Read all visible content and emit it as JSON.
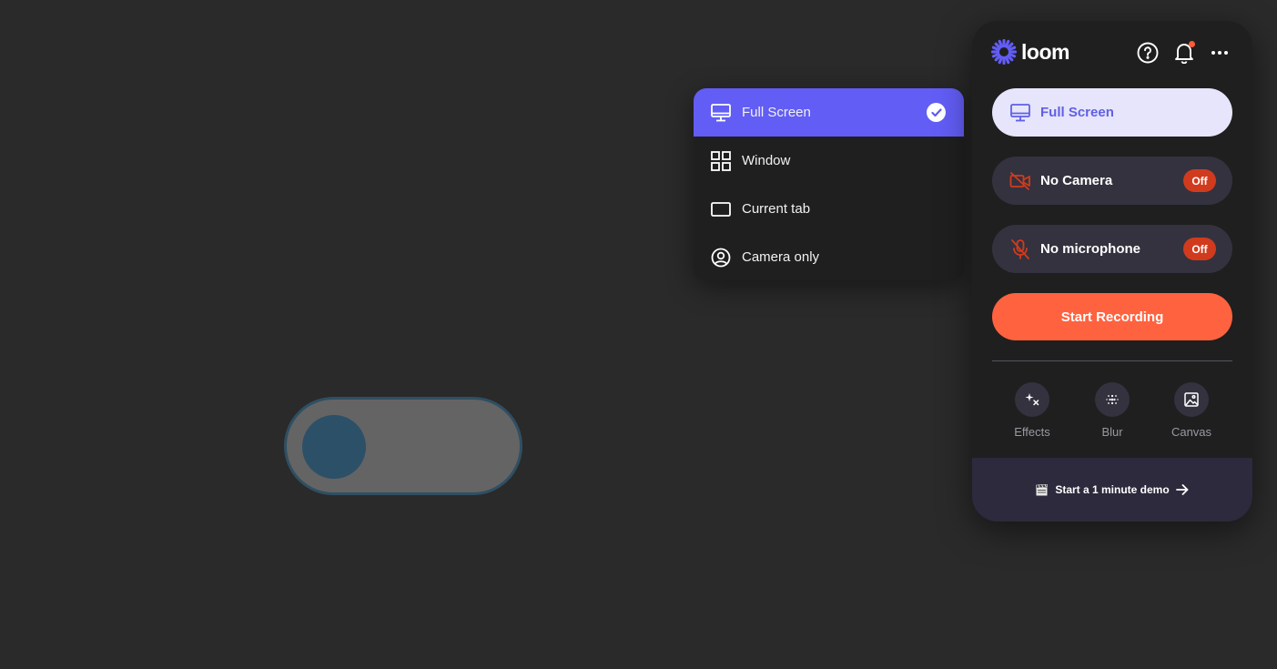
{
  "colors": {
    "accent": "#625df5",
    "record": "#ff623f",
    "off_badge": "#d13b1d",
    "panel_bg": "#1f1f1f"
  },
  "dropdown": {
    "items": [
      {
        "label": "Full Screen",
        "icon": "monitor-icon",
        "selected": true
      },
      {
        "label": "Window",
        "icon": "grid-icon",
        "selected": false
      },
      {
        "label": "Current tab",
        "icon": "tab-icon",
        "selected": false
      },
      {
        "label": "Camera only",
        "icon": "user-circle-icon",
        "selected": false
      }
    ]
  },
  "panel": {
    "logo_text": "loom",
    "header_icons": [
      "help-icon",
      "bell-icon",
      "more-icon"
    ],
    "capture_mode": {
      "label": "Full Screen",
      "icon": "monitor-icon"
    },
    "camera": {
      "label": "No Camera",
      "status": "Off",
      "icon": "camera-off-icon"
    },
    "microphone": {
      "label": "No microphone",
      "status": "Off",
      "icon": "mic-off-icon"
    },
    "start_button": "Start Recording",
    "tools": [
      {
        "label": "Effects",
        "icon": "sparkle-icon"
      },
      {
        "label": "Blur",
        "icon": "blur-icon"
      },
      {
        "label": "Canvas",
        "icon": "image-icon"
      }
    ],
    "footer": {
      "label": "Start a 1 minute demo",
      "icon": "clapperboard-icon"
    }
  },
  "toggle": {
    "on": false
  }
}
